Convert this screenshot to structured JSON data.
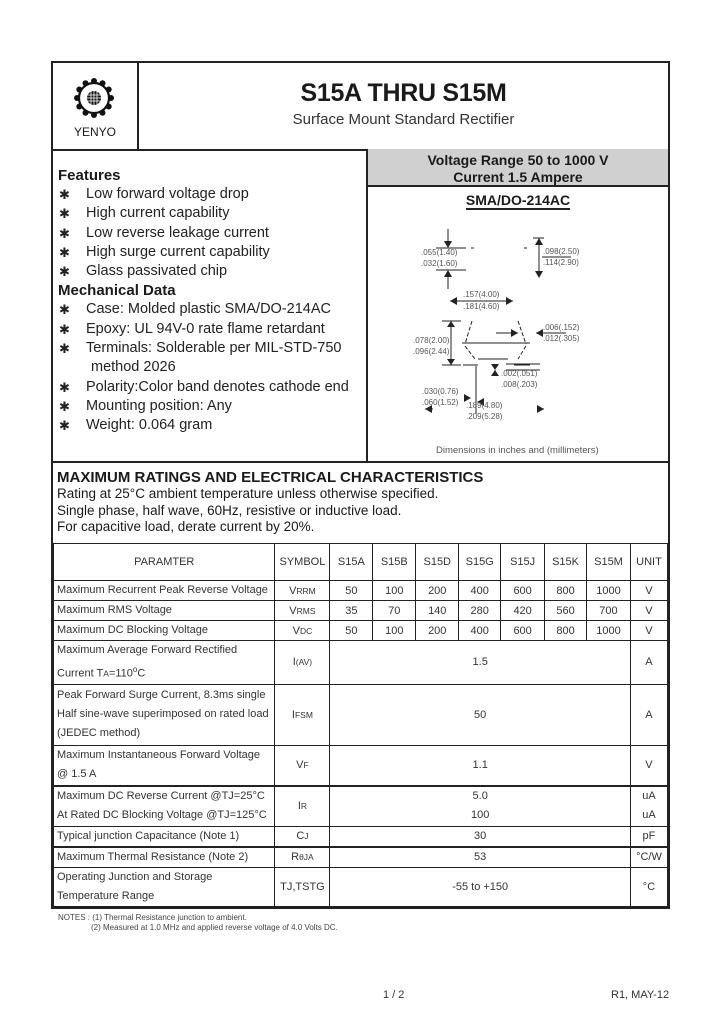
{
  "header": {
    "brand": "YENYO",
    "title": "S15A THRU S15M",
    "subtitle": "Surface Mount Standard Rectifier"
  },
  "features": {
    "heading": "Features",
    "items": [
      "Low forward voltage drop",
      "High current capability",
      "Low reverse leakage current",
      "High surge current capability",
      "Glass passivated chip"
    ]
  },
  "mechanical": {
    "heading": "Mechanical Data",
    "items": [
      {
        "text": "Case: Molded plastic SMA/DO-214AC"
      },
      {
        "text": "Epoxy: UL 94V-0 rate flame retardant"
      },
      {
        "text": "Terminals: Solderable per MIL-STD-750",
        "continuation": "method 2026"
      },
      {
        "text": "Polarity:Color band denotes cathode end"
      },
      {
        "text": "Mounting position: Any"
      },
      {
        "text": "Weight: 0.064 gram"
      }
    ]
  },
  "summary": {
    "voltage_range": "Voltage Range 50 to 1000 V",
    "current": "Current 1.5 Ampere",
    "package": "SMA/DO-214AC"
  },
  "dimensions": {
    "d1": [
      ".055(1.40)",
      ".032(1.60)"
    ],
    "d2": [
      ".098(2.50)",
      ".114(2.90)"
    ],
    "d3": [
      ".157(4.00)",
      ".181(4.60)"
    ],
    "d4": [
      ".006(.152)",
      ".012(.305)"
    ],
    "d5": [
      ".078(2.00)",
      ".096(2.44)"
    ],
    "d6": [
      ".002(.051)",
      ".008(.203)"
    ],
    "d7": [
      ".030(0.76)",
      ".060(1.52)"
    ],
    "d8": [
      ".189(4.80)",
      ".209(5.28)"
    ],
    "caption": "Dimensions in inches and (millimeters)"
  },
  "ratings": {
    "heading": "MAXIMUM RATINGS AND ELECTRICAL CHARACTERISTICS",
    "lines": [
      "Rating at 25°C ambient temperature unless otherwise specified.",
      "Single phase, half wave, 60Hz, resistive or inductive load.",
      "For capacitive load, derate current by 20%."
    ]
  },
  "table": {
    "headers": [
      "PARAMTER",
      "SYMBOL",
      "S15A",
      "S15B",
      "S15D",
      "S15G",
      "S15J",
      "S15K",
      "S15M",
      "UNIT"
    ],
    "rows_per_part": [
      {
        "param": "Maximum Recurrent Peak Reverse Voltage",
        "sym_main": "V",
        "sym_sub": "RRM",
        "values": [
          "50",
          "100",
          "200",
          "400",
          "600",
          "800",
          "1000"
        ],
        "unit": "V"
      },
      {
        "param": "Maximum RMS Voltage",
        "sym_main": "V",
        "sym_sub": "RMS",
        "values": [
          "35",
          "70",
          "140",
          "280",
          "420",
          "560",
          "700"
        ],
        "unit": "V"
      },
      {
        "param": "Maximum DC Blocking Voltage",
        "sym_main": "V",
        "sym_sub": "DC",
        "values": [
          "50",
          "100",
          "200",
          "400",
          "600",
          "800",
          "1000"
        ],
        "unit": "V"
      }
    ],
    "avg_current": {
      "line1": "Maximum Average Forward Rectified",
      "line2_pre": "Current T",
      "line2_sub": "A",
      "line2_post": "=110",
      "line2_sup": "o",
      "line2_end": "C",
      "sym_main": "I",
      "sym_sub": "(AV)",
      "value": "1.5",
      "unit": "A"
    },
    "surge": {
      "line1": "Peak Forward Surge Current, 8.3ms single",
      "line2": "Half sine-wave superimposed on rated load",
      "line3": "(JEDEC method)",
      "sym_main": "I",
      "sym_sub": "FSM",
      "value": "50",
      "unit": "A"
    },
    "vf": {
      "line1": "Maximum Instantaneous Forward Voltage",
      "line2": "@ 1.5 A",
      "sym_main": "V",
      "sym_sub": "F",
      "value": "1.1",
      "unit": "V"
    },
    "ir": {
      "line1": "Maximum DC Reverse Current @TJ=25°C",
      "line2": "At Rated DC Blocking Voltage @TJ=125°C",
      "sym_main": "I",
      "sym_sub": "R",
      "value1": "5.0",
      "value2": "100",
      "unit1": "uA",
      "unit2": "uA"
    },
    "cj": {
      "param": "Typical junction Capacitance (Note 1)",
      "sym_main": "C",
      "sym_sub": "J",
      "value": "30",
      "unit": "pF"
    },
    "rth": {
      "param": "Maximum Thermal Resistance (Note 2)",
      "sym_main": "R",
      "sym_sub": "θJA",
      "value": "53",
      "unit": "°C/W"
    },
    "temp": {
      "line1": "Operating Junction and Storage",
      "line2": "Temperature Range",
      "sym": "TJ,TSTG",
      "value": "-55 to +150",
      "unit": "°C"
    }
  },
  "notes": {
    "n1": "NOTES : (1) Thermal Resistance junction to ambient.",
    "n2": "(2) Measured at 1.0 MHz and applied reverse voltage of 4.0 Volts DC."
  },
  "footer": {
    "page": "1 / 2",
    "revision": "R1, MAY-12"
  }
}
